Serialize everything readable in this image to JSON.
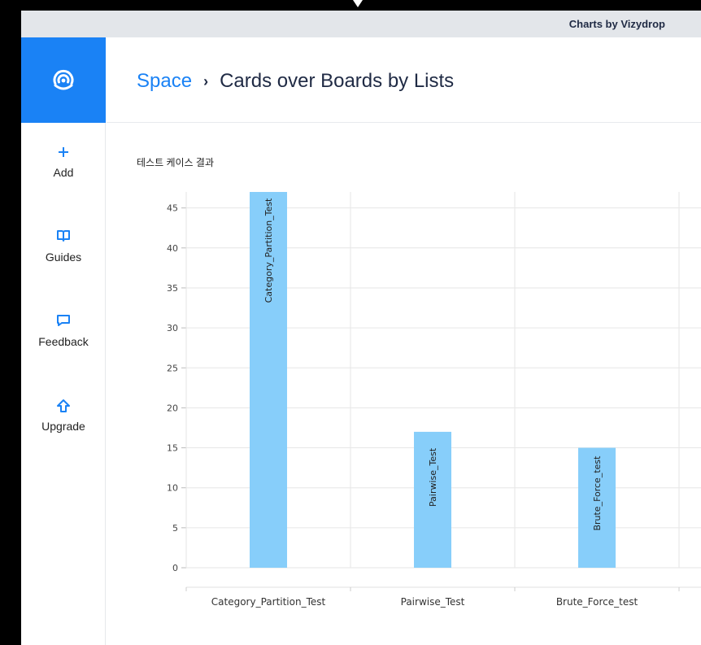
{
  "app": {
    "title": "Charts by Vizydrop"
  },
  "sidebar": {
    "logo_icon": "vizydrop-logo-icon",
    "items": [
      {
        "label": "Add",
        "icon": "plus-icon"
      },
      {
        "label": "Guides",
        "icon": "book-icon"
      },
      {
        "label": "Feedback",
        "icon": "chat-bubble-icon"
      },
      {
        "label": "Upgrade",
        "icon": "arrow-up-icon"
      }
    ]
  },
  "header": {
    "breadcrumb_root": "Space",
    "breadcrumb_separator": "›",
    "page_title": "Cards over Boards by Lists"
  },
  "colors": {
    "accent": "#1a82f5",
    "bar": "#87cefa",
    "titlebar": "#e3e6ea"
  },
  "chart_data": {
    "type": "bar",
    "title": "테스트 케이스 결과",
    "categories": [
      "Category_Partition_Test",
      "Pairwise_Test",
      "Brute_Force_test"
    ],
    "values": [
      47,
      17,
      15
    ],
    "bar_labels": [
      "Category_Partition_Test",
      "Pairwise_Test",
      "Brute_Force_test"
    ],
    "y_ticks": [
      0,
      5,
      10,
      15,
      20,
      25,
      30,
      35,
      40,
      45
    ],
    "ylim": [
      0,
      47
    ],
    "grid": true
  }
}
